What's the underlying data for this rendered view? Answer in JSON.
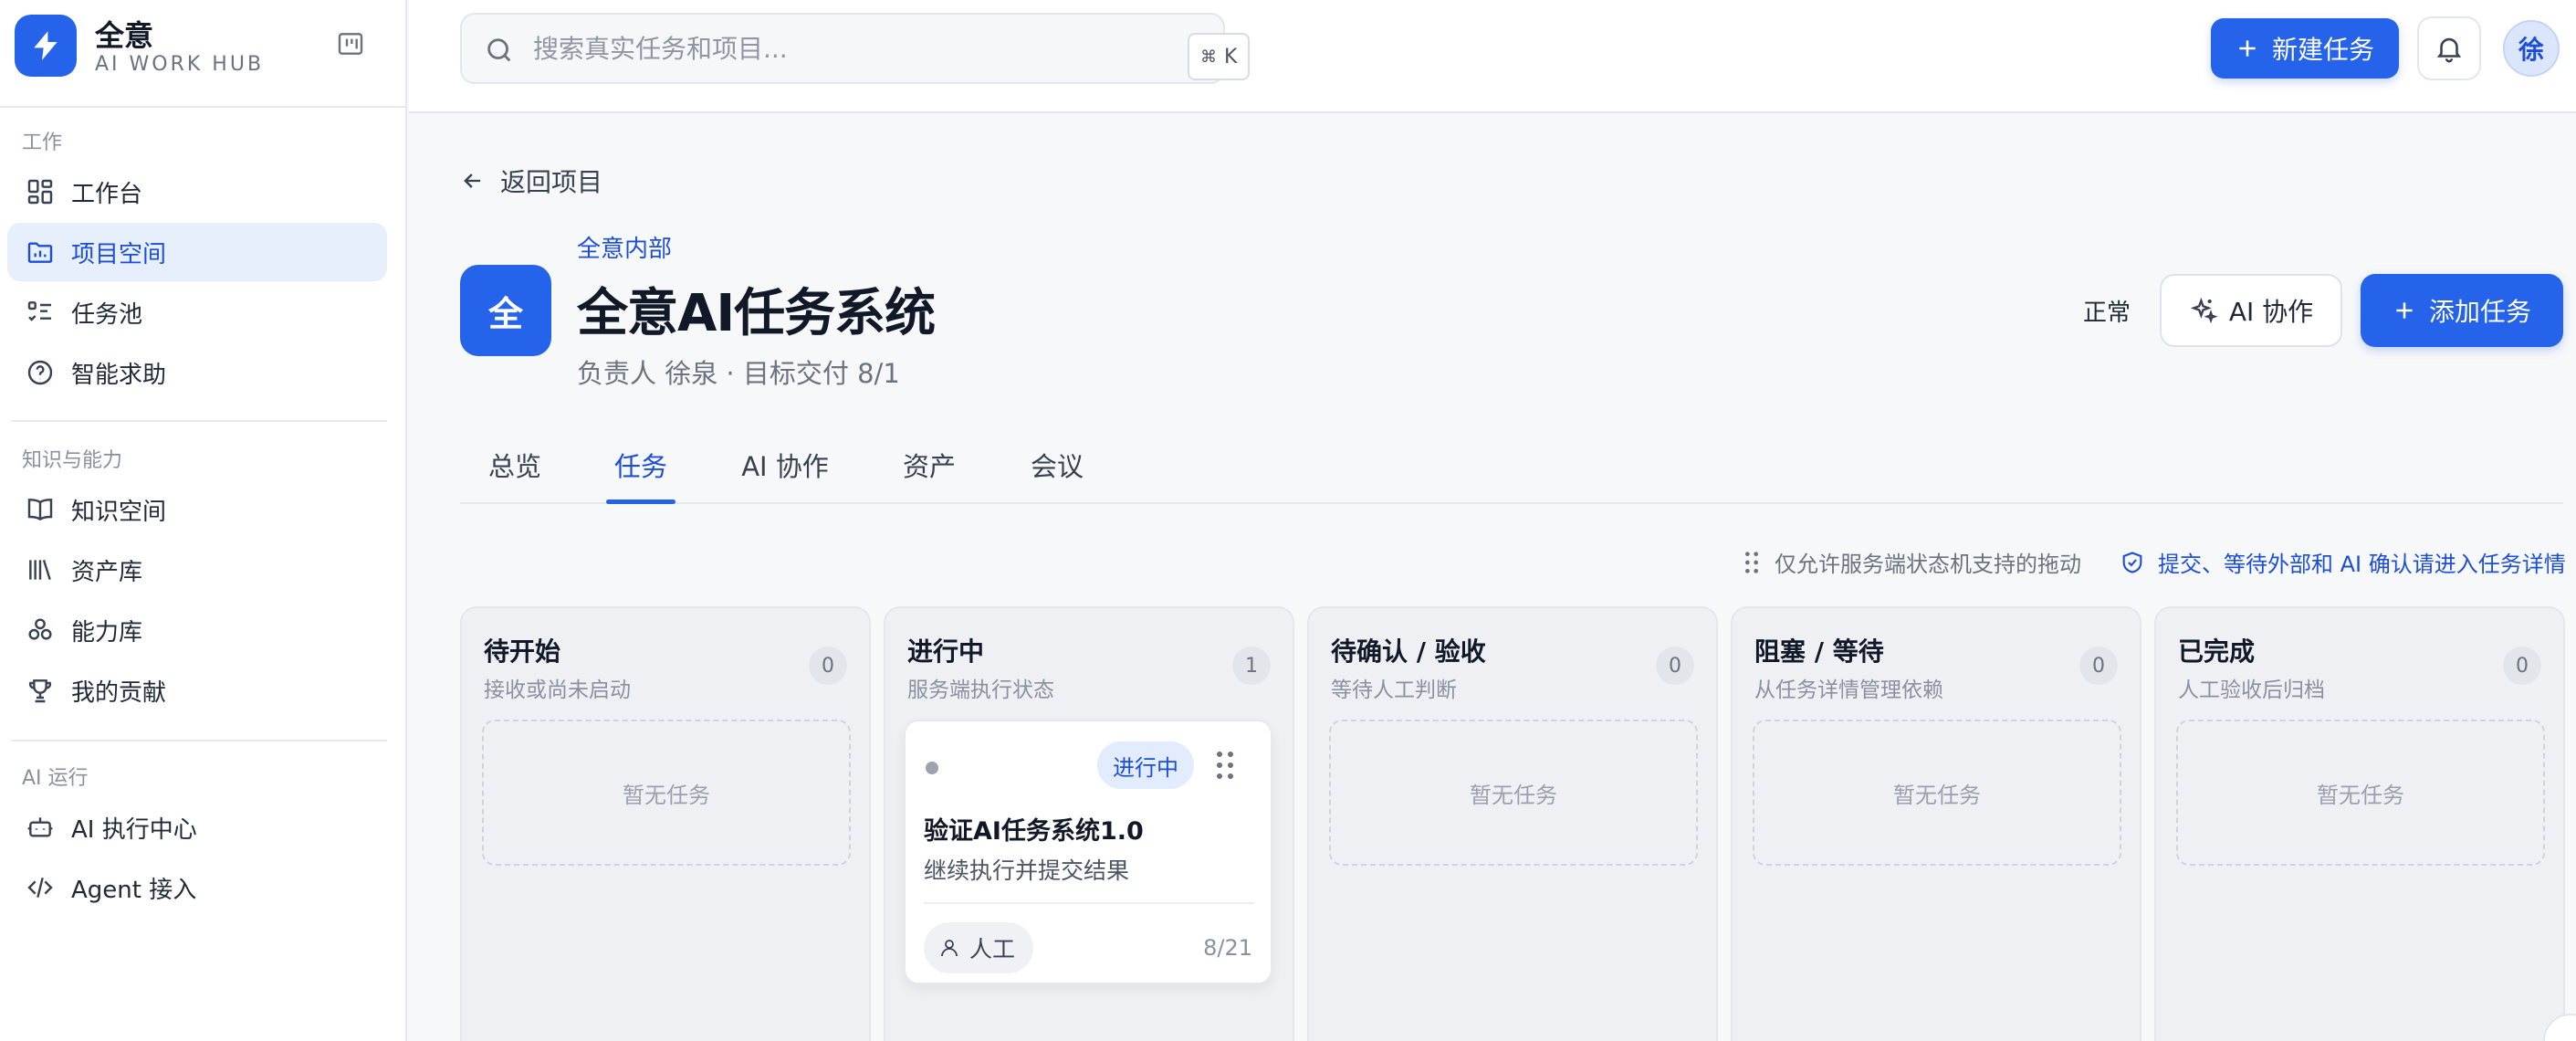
{
  "brand": {
    "name": "全意",
    "subtitle": "AI WORK HUB"
  },
  "sidebar": {
    "sections": [
      {
        "title": "工作",
        "items": [
          {
            "label": "工作台",
            "icon": "dashboard-icon"
          },
          {
            "label": "项目空间",
            "icon": "folder-icon",
            "active": true
          },
          {
            "label": "任务池",
            "icon": "checklist-icon"
          },
          {
            "label": "智能求助",
            "icon": "help-circle-icon"
          }
        ]
      },
      {
        "title": "知识与能力",
        "items": [
          {
            "label": "知识空间",
            "icon": "book-icon"
          },
          {
            "label": "资产库",
            "icon": "library-icon"
          },
          {
            "label": "能力库",
            "icon": "blocks-icon"
          },
          {
            "label": "我的贡献",
            "icon": "trophy-icon"
          }
        ]
      },
      {
        "title": "AI 运行",
        "items": [
          {
            "label": "AI 执行中心",
            "icon": "robot-icon"
          },
          {
            "label": "Agent 接入",
            "icon": "code-icon"
          }
        ]
      }
    ]
  },
  "topbar": {
    "search_placeholder": "搜索真实任务和项目...",
    "shortcut_symbol": "⌘",
    "shortcut_key": "K",
    "new_task_label": "新建任务",
    "avatar_initial": "徐"
  },
  "project": {
    "back_label": "返回项目",
    "logo_initial": "全",
    "org": "全意内部",
    "title": "全意AI任务系统",
    "meta": "负责人 徐泉 · 目标交付 8/1",
    "status": "正常",
    "ai_button_label": "AI 协作",
    "add_task_label": "添加任务"
  },
  "tabs": [
    {
      "label": "总览"
    },
    {
      "label": "任务",
      "active": true
    },
    {
      "label": "AI 协作"
    },
    {
      "label": "资产"
    },
    {
      "label": "会议"
    }
  ],
  "hints": {
    "drag": "仅允许服务端状态机支持的拖动",
    "confirm": "提交、等待外部和 AI 确认请进入任务详情"
  },
  "board": {
    "empty_label": "暂无任务",
    "columns": [
      {
        "title": "待开始",
        "subtitle": "接收或尚未启动",
        "count": "0"
      },
      {
        "title": "进行中",
        "subtitle": "服务端执行状态",
        "count": "1"
      },
      {
        "title": "待确认 / 验收",
        "subtitle": "等待人工判断",
        "count": "0"
      },
      {
        "title": "阻塞 / 等待",
        "subtitle": "从任务详情管理依赖",
        "count": "0"
      },
      {
        "title": "已完成",
        "subtitle": "人工验收后归档",
        "count": "0"
      }
    ],
    "task": {
      "status": "进行中",
      "title": "验证AI任务系统1.0",
      "description": "继续执行并提交结果",
      "assignee": "人工",
      "date": "8/21"
    }
  },
  "colors": {
    "accent": "#2563eb",
    "accent_soft": "#e7effd",
    "border": "#e6e8ee"
  }
}
